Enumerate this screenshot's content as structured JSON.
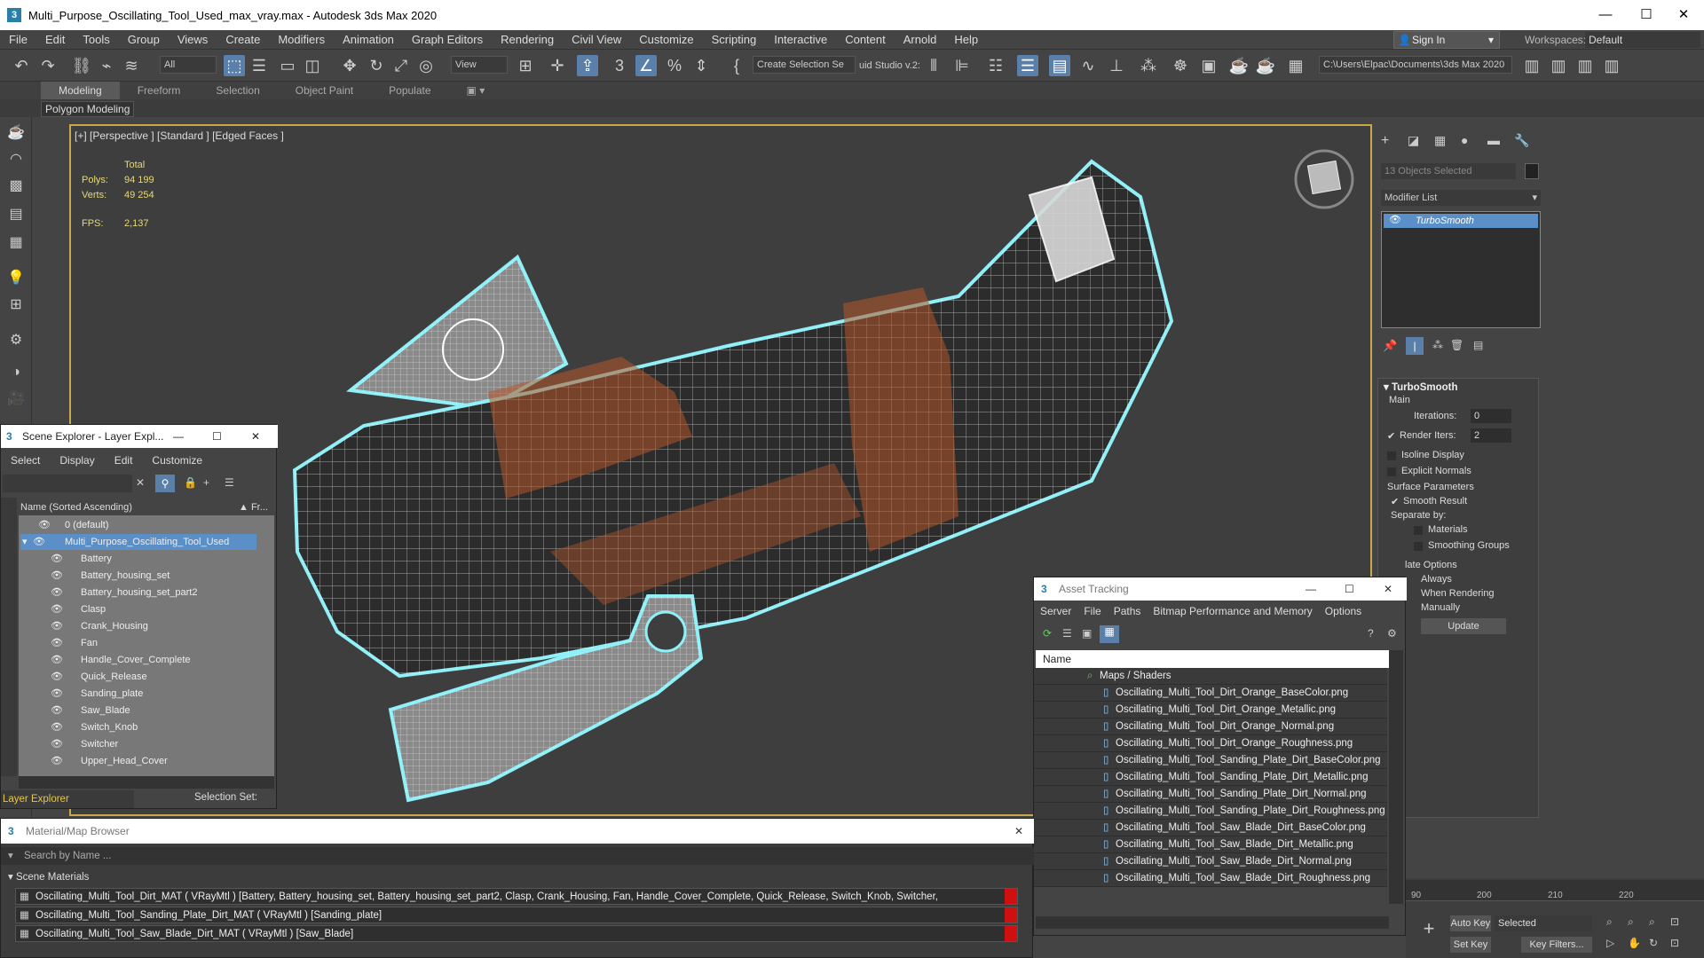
{
  "window": {
    "title": "Multi_Purpose_Oscillating_Tool_Used_max_vray.max - Autodesk 3ds Max 2020",
    "app_glyph": "3",
    "minimize": "—",
    "maximize": "☐",
    "close": "✕"
  },
  "menubar": {
    "items": [
      "File",
      "Edit",
      "Tools",
      "Group",
      "Views",
      "Create",
      "Modifiers",
      "Animation",
      "Graph Editors",
      "Rendering",
      "Civil View",
      "Customize",
      "Scripting",
      "Interactive",
      "Content",
      "Arnold",
      "Help"
    ],
    "sign_in": "Sign In",
    "workspaces_label": "Workspaces:",
    "workspace_value": "Default"
  },
  "toolbar": {
    "filter_all": "All",
    "view": "View",
    "create_selection_set": "Create Selection Se",
    "studio": "uid Studio v.2:",
    "project_path": "C:\\Users\\Elpac\\Documents\\3ds Max 2020"
  },
  "ribbon": {
    "tabs": [
      "Modeling",
      "Freeform",
      "Selection",
      "Object Paint",
      "Populate"
    ],
    "active": "Modeling",
    "panel": "Polygon Modeling"
  },
  "viewport": {
    "label": "[+] [Perspective ] [Standard ] [Edged Faces ]",
    "stats": {
      "header": "Total",
      "polys_label": "Polys:",
      "polys": "94 199",
      "verts_label": "Verts:",
      "verts": "49 254",
      "fps_label": "FPS:",
      "fps": "2,137"
    },
    "wire_color": "#8ff0f8"
  },
  "command_panel": {
    "objects_selected": "13 Objects Selected",
    "modifier_list": "Modifier List",
    "stack_item": "TurboSmooth",
    "rollout": "TurboSmooth",
    "main": "Main",
    "iterations_label": "Iterations:",
    "iterations": "0",
    "render_iters_label": "Render Iters:",
    "render_iters": "2",
    "isoline": "Isoline Display",
    "explicit": "Explicit Normals",
    "surface_params": "Surface Parameters",
    "smooth_result": "Smooth Result",
    "separate_by": "Separate by:",
    "materials": "Materials",
    "smoothing_groups": "Smoothing Groups",
    "update_options": "late Options",
    "always": "Always",
    "when_rendering": "When Rendering",
    "manually": "Manually",
    "update": "Update"
  },
  "scene_explorer": {
    "title": "Scene Explorer - Layer Expl...",
    "menu": [
      "Select",
      "Display",
      "Edit",
      "Customize"
    ],
    "col_name": "Name (Sorted Ascending)",
    "col_fr": "▲ Fr...",
    "layer_default": "0 (default)",
    "layer_main": "Multi_Purpose_Oscillating_Tool_Used",
    "objects": [
      "Battery",
      "Battery_housing_set",
      "Battery_housing_set_part2",
      "Clasp",
      "Crank_Housing",
      "Fan",
      "Handle_Cover_Complete",
      "Quick_Release",
      "Sanding_plate",
      "Saw_Blade",
      "Switch_Knob",
      "Switcher",
      "Upper_Head_Cover"
    ],
    "footer_dropdown": "Layer Explorer",
    "footer_selection": "Selection Set:"
  },
  "asset_tracking": {
    "title": "Asset Tracking",
    "menu": [
      "Server",
      "File",
      "Paths",
      "Bitmap Performance and Memory",
      "Options"
    ],
    "col_name": "Name",
    "group": "Maps / Shaders",
    "files": [
      "Oscillating_Multi_Tool_Dirt_Orange_BaseColor.png",
      "Oscillating_Multi_Tool_Dirt_Orange_Metallic.png",
      "Oscillating_Multi_Tool_Dirt_Orange_Normal.png",
      "Oscillating_Multi_Tool_Dirt_Orange_Roughness.png",
      "Oscillating_Multi_Tool_Sanding_Plate_Dirt_BaseColor.png",
      "Oscillating_Multi_Tool_Sanding_Plate_Dirt_Metallic.png",
      "Oscillating_Multi_Tool_Sanding_Plate_Dirt_Normal.png",
      "Oscillating_Multi_Tool_Sanding_Plate_Dirt_Roughness.png",
      "Oscillating_Multi_Tool_Saw_Blade_Dirt_BaseColor.png",
      "Oscillating_Multi_Tool_Saw_Blade_Dirt_Metallic.png",
      "Oscillating_Multi_Tool_Saw_Blade_Dirt_Normal.png",
      "Oscillating_Multi_Tool_Saw_Blade_Dirt_Roughness.png"
    ]
  },
  "material_browser": {
    "title": "Material/Map Browser",
    "search": "Search by Name ...",
    "section": "Scene Materials",
    "materials": [
      "Oscillating_Multi_Tool_Dirt_MAT ( VRayMtl ) [Battery, Battery_housing_set, Battery_housing_set_part2, Clasp, Crank_Housing, Fan, Handle_Cover_Complete, Quick_Release, Switch_Knob, Switcher, Upper_Head_Cover]",
      "Oscillating_Multi_Tool_Sanding_Plate_Dirt_MAT ( VRayMtl ) [Sanding_plate]",
      "Oscillating_Multi_Tool_Saw_Blade_Dirt_MAT ( VRayMtl ) [Saw_Blade]"
    ]
  },
  "timeline": {
    "ticks": [
      "90",
      "200",
      "210",
      "220"
    ],
    "auto_key": "Auto Key",
    "set_key": "Set Key",
    "selected": "Selected",
    "key_filters": "Key Filters..."
  }
}
